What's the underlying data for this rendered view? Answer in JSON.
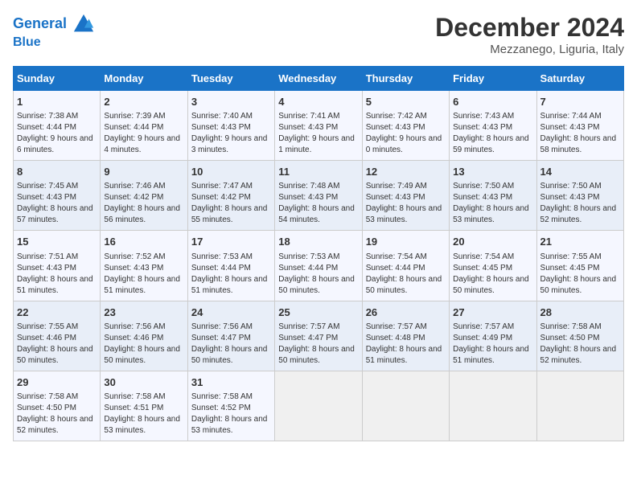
{
  "header": {
    "logo_line1": "General",
    "logo_line2": "Blue",
    "month": "December 2024",
    "location": "Mezzanego, Liguria, Italy"
  },
  "weekdays": [
    "Sunday",
    "Monday",
    "Tuesday",
    "Wednesday",
    "Thursday",
    "Friday",
    "Saturday"
  ],
  "weeks": [
    [
      {
        "day": "1",
        "sunrise": "7:38 AM",
        "sunset": "4:44 PM",
        "daylight": "9 hours and 6 minutes."
      },
      {
        "day": "2",
        "sunrise": "7:39 AM",
        "sunset": "4:44 PM",
        "daylight": "9 hours and 4 minutes."
      },
      {
        "day": "3",
        "sunrise": "7:40 AM",
        "sunset": "4:43 PM",
        "daylight": "9 hours and 3 minutes."
      },
      {
        "day": "4",
        "sunrise": "7:41 AM",
        "sunset": "4:43 PM",
        "daylight": "9 hours and 1 minute."
      },
      {
        "day": "5",
        "sunrise": "7:42 AM",
        "sunset": "4:43 PM",
        "daylight": "9 hours and 0 minutes."
      },
      {
        "day": "6",
        "sunrise": "7:43 AM",
        "sunset": "4:43 PM",
        "daylight": "8 hours and 59 minutes."
      },
      {
        "day": "7",
        "sunrise": "7:44 AM",
        "sunset": "4:43 PM",
        "daylight": "8 hours and 58 minutes."
      }
    ],
    [
      {
        "day": "8",
        "sunrise": "7:45 AM",
        "sunset": "4:43 PM",
        "daylight": "8 hours and 57 minutes."
      },
      {
        "day": "9",
        "sunrise": "7:46 AM",
        "sunset": "4:42 PM",
        "daylight": "8 hours and 56 minutes."
      },
      {
        "day": "10",
        "sunrise": "7:47 AM",
        "sunset": "4:42 PM",
        "daylight": "8 hours and 55 minutes."
      },
      {
        "day": "11",
        "sunrise": "7:48 AM",
        "sunset": "4:43 PM",
        "daylight": "8 hours and 54 minutes."
      },
      {
        "day": "12",
        "sunrise": "7:49 AM",
        "sunset": "4:43 PM",
        "daylight": "8 hours and 53 minutes."
      },
      {
        "day": "13",
        "sunrise": "7:50 AM",
        "sunset": "4:43 PM",
        "daylight": "8 hours and 53 minutes."
      },
      {
        "day": "14",
        "sunrise": "7:50 AM",
        "sunset": "4:43 PM",
        "daylight": "8 hours and 52 minutes."
      }
    ],
    [
      {
        "day": "15",
        "sunrise": "7:51 AM",
        "sunset": "4:43 PM",
        "daylight": "8 hours and 51 minutes."
      },
      {
        "day": "16",
        "sunrise": "7:52 AM",
        "sunset": "4:43 PM",
        "daylight": "8 hours and 51 minutes."
      },
      {
        "day": "17",
        "sunrise": "7:53 AM",
        "sunset": "4:44 PM",
        "daylight": "8 hours and 51 minutes."
      },
      {
        "day": "18",
        "sunrise": "7:53 AM",
        "sunset": "4:44 PM",
        "daylight": "8 hours and 50 minutes."
      },
      {
        "day": "19",
        "sunrise": "7:54 AM",
        "sunset": "4:44 PM",
        "daylight": "8 hours and 50 minutes."
      },
      {
        "day": "20",
        "sunrise": "7:54 AM",
        "sunset": "4:45 PM",
        "daylight": "8 hours and 50 minutes."
      },
      {
        "day": "21",
        "sunrise": "7:55 AM",
        "sunset": "4:45 PM",
        "daylight": "8 hours and 50 minutes."
      }
    ],
    [
      {
        "day": "22",
        "sunrise": "7:55 AM",
        "sunset": "4:46 PM",
        "daylight": "8 hours and 50 minutes."
      },
      {
        "day": "23",
        "sunrise": "7:56 AM",
        "sunset": "4:46 PM",
        "daylight": "8 hours and 50 minutes."
      },
      {
        "day": "24",
        "sunrise": "7:56 AM",
        "sunset": "4:47 PM",
        "daylight": "8 hours and 50 minutes."
      },
      {
        "day": "25",
        "sunrise": "7:57 AM",
        "sunset": "4:47 PM",
        "daylight": "8 hours and 50 minutes."
      },
      {
        "day": "26",
        "sunrise": "7:57 AM",
        "sunset": "4:48 PM",
        "daylight": "8 hours and 51 minutes."
      },
      {
        "day": "27",
        "sunrise": "7:57 AM",
        "sunset": "4:49 PM",
        "daylight": "8 hours and 51 minutes."
      },
      {
        "day": "28",
        "sunrise": "7:58 AM",
        "sunset": "4:50 PM",
        "daylight": "8 hours and 52 minutes."
      }
    ],
    [
      {
        "day": "29",
        "sunrise": "7:58 AM",
        "sunset": "4:50 PM",
        "daylight": "8 hours and 52 minutes."
      },
      {
        "day": "30",
        "sunrise": "7:58 AM",
        "sunset": "4:51 PM",
        "daylight": "8 hours and 53 minutes."
      },
      {
        "day": "31",
        "sunrise": "7:58 AM",
        "sunset": "4:52 PM",
        "daylight": "8 hours and 53 minutes."
      },
      null,
      null,
      null,
      null
    ]
  ]
}
